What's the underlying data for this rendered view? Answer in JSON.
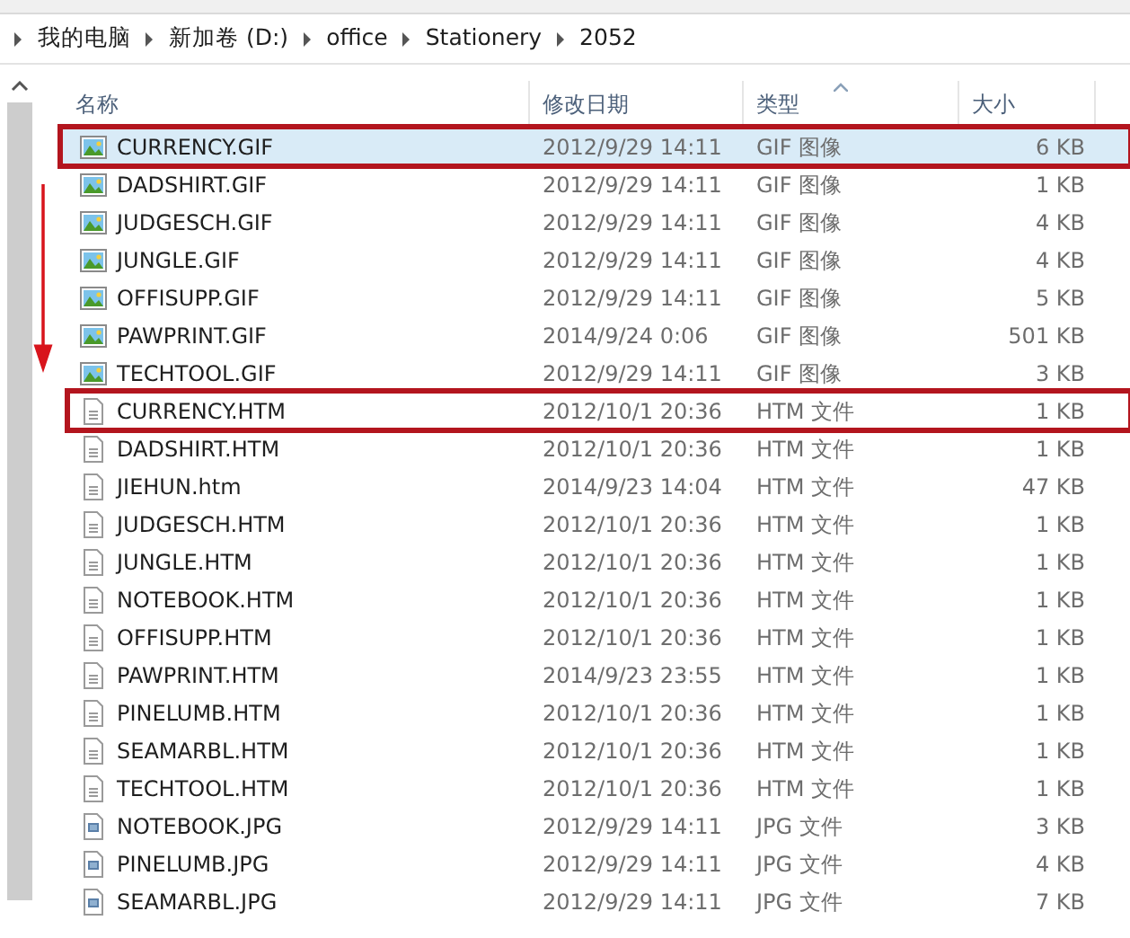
{
  "breadcrumb": [
    "我的电脑",
    "新加卷 (D:)",
    "office",
    "Stationery",
    "2052"
  ],
  "table": {
    "columns": [
      {
        "label": "名称",
        "sorted": false
      },
      {
        "label": "修改日期",
        "sorted": false
      },
      {
        "label": "类型",
        "sorted": true
      },
      {
        "label": "大小",
        "sorted": false
      }
    ],
    "rows": [
      {
        "kind": "gif",
        "name": "CURRENCY.GIF",
        "date": "2012/9/29 14:11",
        "type": "GIF 图像",
        "size": "6 KB",
        "selected": true,
        "marked": true
      },
      {
        "kind": "gif",
        "name": "DADSHIRT.GIF",
        "date": "2012/9/29 14:11",
        "type": "GIF 图像",
        "size": "1 KB",
        "selected": false,
        "marked": false
      },
      {
        "kind": "gif",
        "name": "JUDGESCH.GIF",
        "date": "2012/9/29 14:11",
        "type": "GIF 图像",
        "size": "4 KB",
        "selected": false,
        "marked": false
      },
      {
        "kind": "gif",
        "name": "JUNGLE.GIF",
        "date": "2012/9/29 14:11",
        "type": "GIF 图像",
        "size": "4 KB",
        "selected": false,
        "marked": false
      },
      {
        "kind": "gif",
        "name": "OFFISUPP.GIF",
        "date": "2012/9/29 14:11",
        "type": "GIF 图像",
        "size": "5 KB",
        "selected": false,
        "marked": false
      },
      {
        "kind": "gif",
        "name": "PAWPRINT.GIF",
        "date": "2014/9/24 0:06",
        "type": "GIF 图像",
        "size": "501 KB",
        "selected": false,
        "marked": false
      },
      {
        "kind": "gif",
        "name": "TECHTOOL.GIF",
        "date": "2012/9/29 14:11",
        "type": "GIF 图像",
        "size": "3 KB",
        "selected": false,
        "marked": false
      },
      {
        "kind": "htm",
        "name": "CURRENCY.HTM",
        "date": "2012/10/1 20:36",
        "type": "HTM 文件",
        "size": "1 KB",
        "selected": false,
        "marked": true
      },
      {
        "kind": "htm",
        "name": "DADSHIRT.HTM",
        "date": "2012/10/1 20:36",
        "type": "HTM 文件",
        "size": "1 KB",
        "selected": false,
        "marked": false
      },
      {
        "kind": "htm",
        "name": "JIEHUN.htm",
        "date": "2014/9/23 14:04",
        "type": "HTM 文件",
        "size": "47 KB",
        "selected": false,
        "marked": false
      },
      {
        "kind": "htm",
        "name": "JUDGESCH.HTM",
        "date": "2012/10/1 20:36",
        "type": "HTM 文件",
        "size": "1 KB",
        "selected": false,
        "marked": false
      },
      {
        "kind": "htm",
        "name": "JUNGLE.HTM",
        "date": "2012/10/1 20:36",
        "type": "HTM 文件",
        "size": "1 KB",
        "selected": false,
        "marked": false
      },
      {
        "kind": "htm",
        "name": "NOTEBOOK.HTM",
        "date": "2012/10/1 20:36",
        "type": "HTM 文件",
        "size": "1 KB",
        "selected": false,
        "marked": false
      },
      {
        "kind": "htm",
        "name": "OFFISUPP.HTM",
        "date": "2012/10/1 20:36",
        "type": "HTM 文件",
        "size": "1 KB",
        "selected": false,
        "marked": false
      },
      {
        "kind": "htm",
        "name": "PAWPRINT.HTM",
        "date": "2014/9/23 23:55",
        "type": "HTM 文件",
        "size": "1 KB",
        "selected": false,
        "marked": false
      },
      {
        "kind": "htm",
        "name": "PINELUMB.HTM",
        "date": "2012/10/1 20:36",
        "type": "HTM 文件",
        "size": "1 KB",
        "selected": false,
        "marked": false
      },
      {
        "kind": "htm",
        "name": "SEAMARBL.HTM",
        "date": "2012/10/1 20:36",
        "type": "HTM 文件",
        "size": "1 KB",
        "selected": false,
        "marked": false
      },
      {
        "kind": "htm",
        "name": "TECHTOOL.HTM",
        "date": "2012/10/1 20:36",
        "type": "HTM 文件",
        "size": "1 KB",
        "selected": false,
        "marked": false
      },
      {
        "kind": "jpg",
        "name": "NOTEBOOK.JPG",
        "date": "2012/9/29 14:11",
        "type": "JPG 文件",
        "size": "3 KB",
        "selected": false,
        "marked": false
      },
      {
        "kind": "jpg",
        "name": "PINELUMB.JPG",
        "date": "2012/9/29 14:11",
        "type": "JPG 文件",
        "size": "4 KB",
        "selected": false,
        "marked": false
      },
      {
        "kind": "jpg",
        "name": "SEAMARBL.JPG",
        "date": "2012/9/29 14:11",
        "type": "JPG 文件",
        "size": "7 KB",
        "selected": false,
        "marked": false
      }
    ]
  }
}
